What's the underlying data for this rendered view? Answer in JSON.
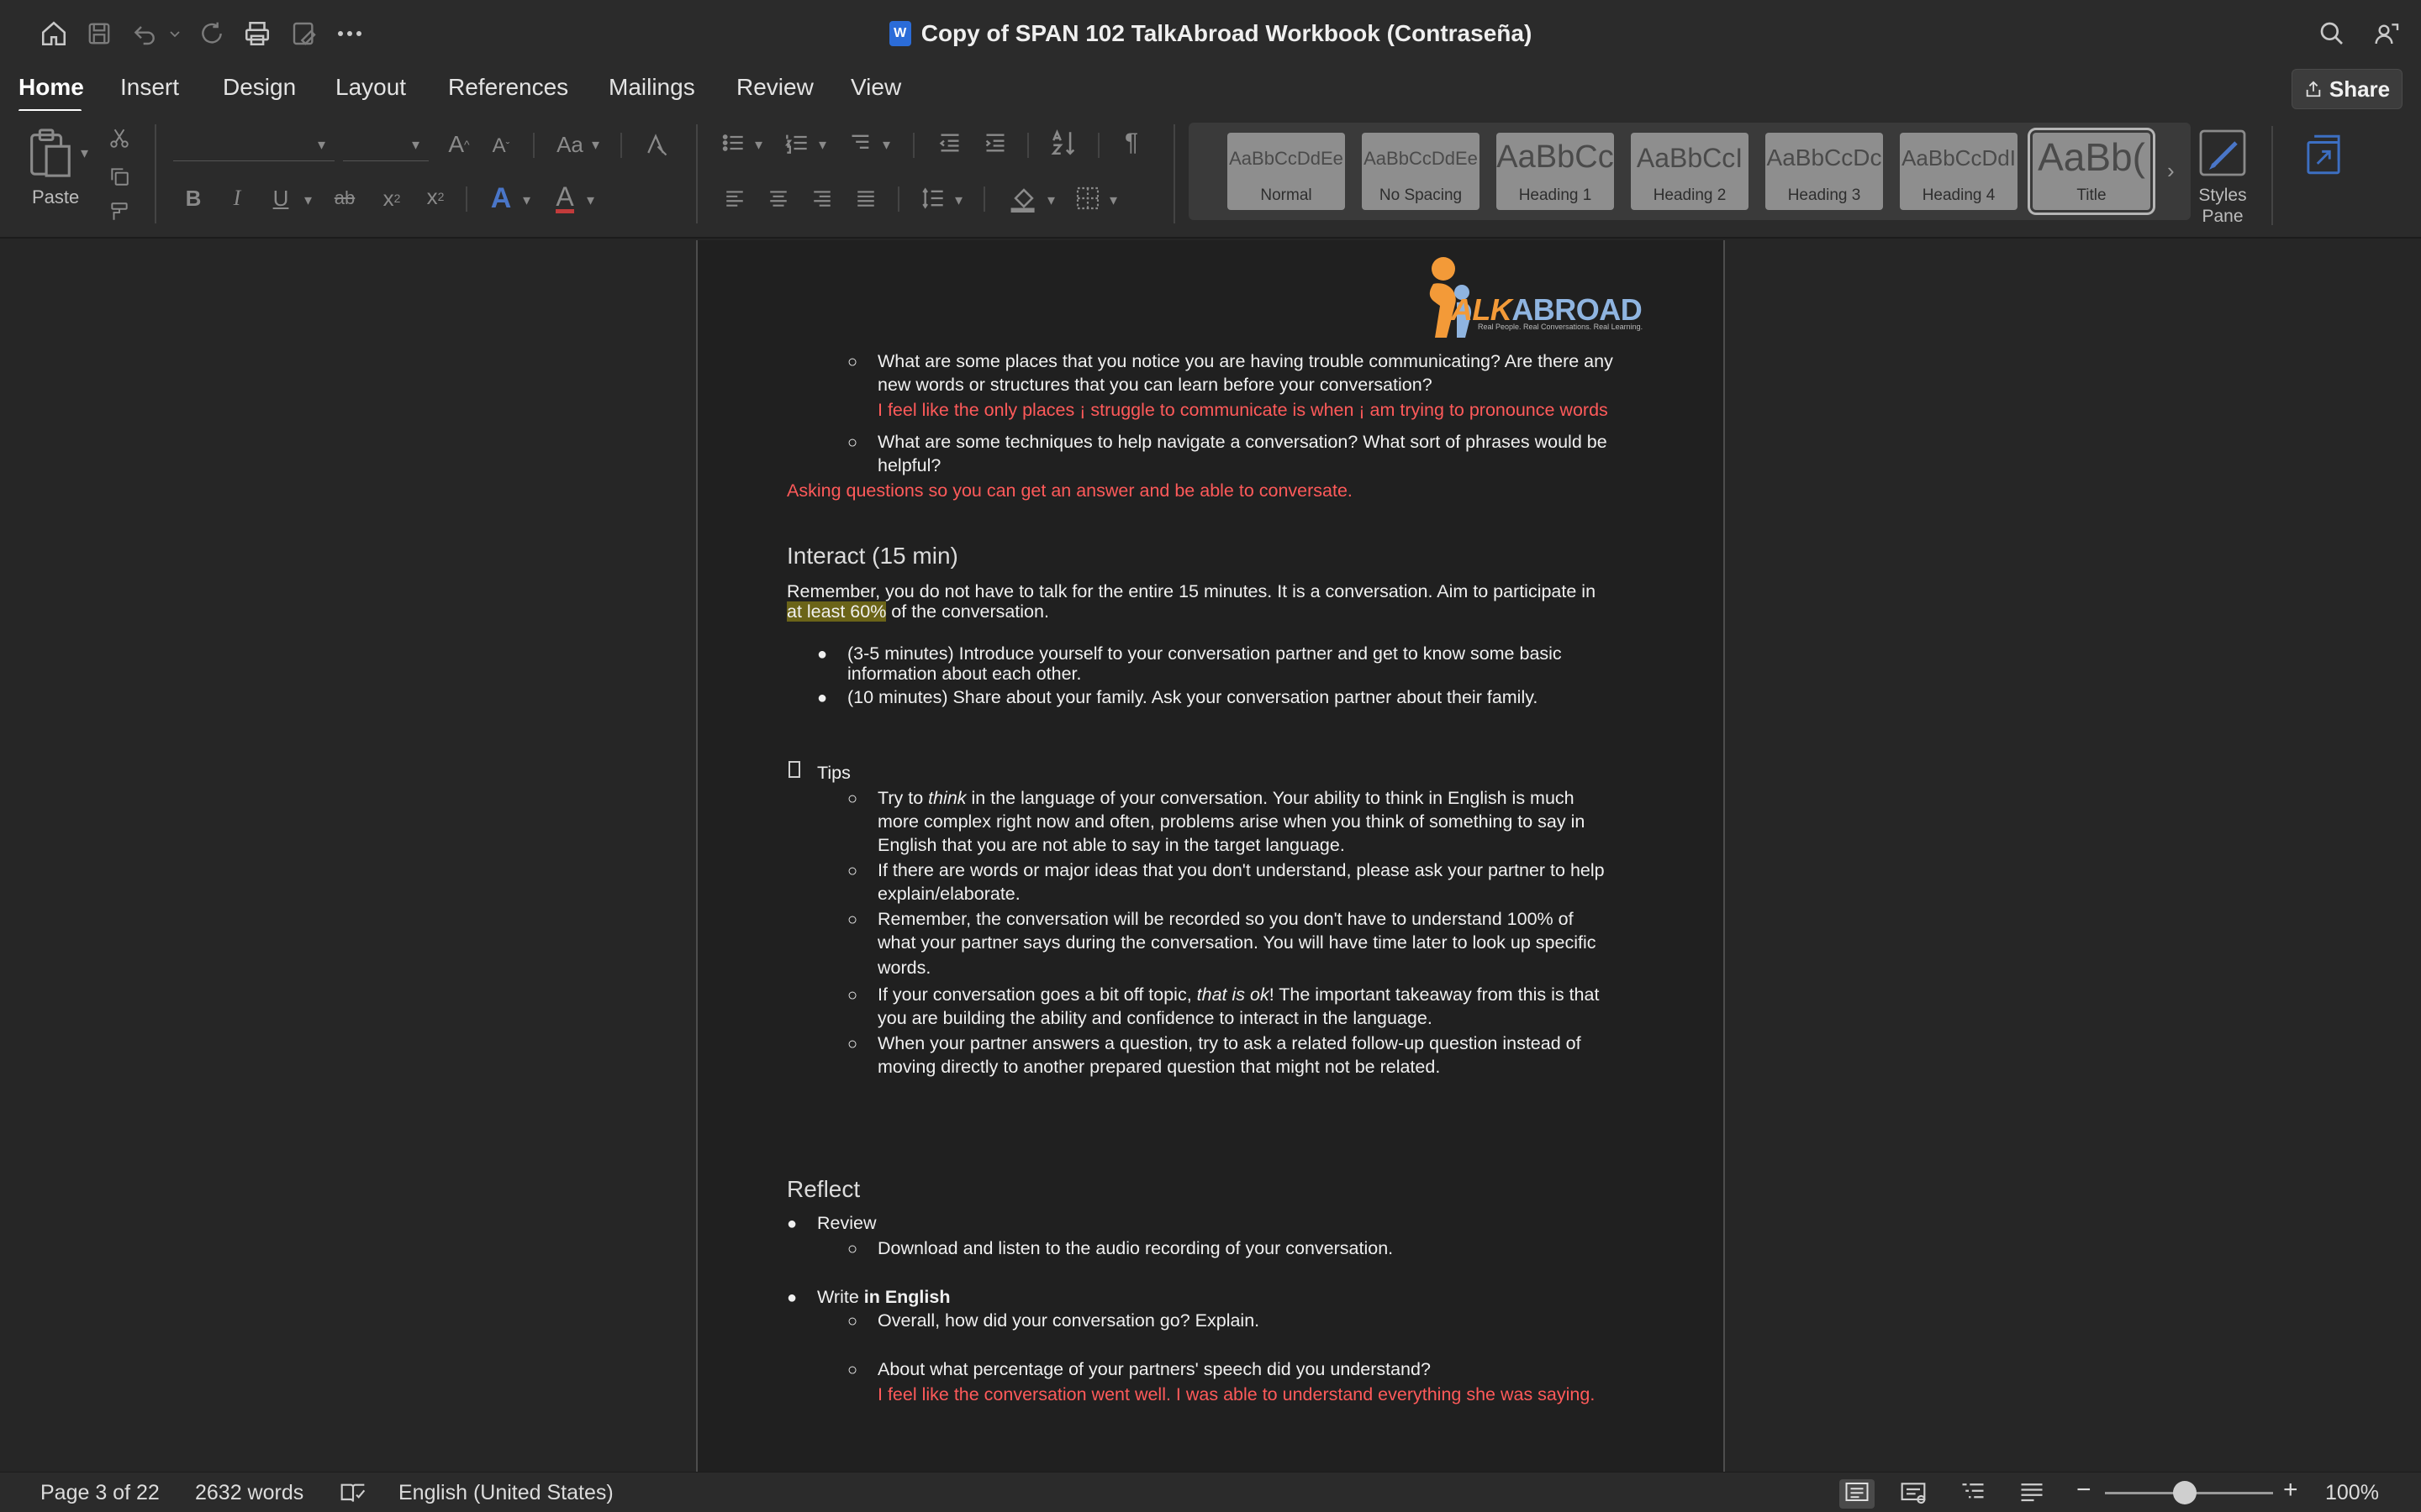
{
  "window": {
    "title": "Copy of SPAN 102 TalkAbroad Workbook (Contraseña)",
    "app_icon": "W"
  },
  "tabs": [
    {
      "label": "Home",
      "active": true
    },
    {
      "label": "Insert"
    },
    {
      "label": "Design"
    },
    {
      "label": "Layout"
    },
    {
      "label": "References"
    },
    {
      "label": "Mailings"
    },
    {
      "label": "Review"
    },
    {
      "label": "View"
    }
  ],
  "share_label": "Share",
  "ribbon": {
    "paste_label": "Paste",
    "font_size_label": "Aa",
    "styles": [
      {
        "sample": "AaBbCcDdEe",
        "label": "Normal",
        "size": "small"
      },
      {
        "sample": "AaBbCcDdEe",
        "label": "No Spacing",
        "size": "small"
      },
      {
        "sample": "AaBbCc",
        "label": "Heading 1",
        "size": "large"
      },
      {
        "sample": "AaBbCcI",
        "label": "Heading 2",
        "size": "medium"
      },
      {
        "sample": "AaBbCcDc",
        "label": "Heading 3",
        "size": "medium-small"
      },
      {
        "sample": "AaBbCcDdI",
        "label": "Heading 4",
        "size": "medium-small"
      },
      {
        "sample": "AaBb(",
        "label": "Title",
        "size": "xlarge",
        "selected": true
      }
    ],
    "styles_pane_label": "Styles Pane"
  },
  "logo": {
    "brand_talk": "TALK",
    "brand_abroad": "ABROAD",
    "tagline": "Real People. Real Conversations. Real Learning."
  },
  "document": {
    "q1_line1": "What are some places that you notice you are having trouble communicating? Are there any",
    "q1_line2": "new words or structures that you can learn before your conversation?",
    "a1": "I feel like the only places ¡ struggle to communicate is when ¡ am trying to pronounce words",
    "q2_line1": "What are some techniques to help navigate a conversation? What sort of phrases would be",
    "q2_line2": "helpful?",
    "a2": "Asking questions so you can get an answer and be able to conversate.",
    "interact_heading": "Interact (15 min)",
    "interact_p_line1": "Remember, you do not have to talk for the entire 15 minutes. It is a conversation. Aim to participate in",
    "interact_p_highlight": "at least 60%",
    "interact_p_rest": " of the conversation.",
    "b1_line1": "(3-5 minutes) Introduce yourself to your conversation partner and get to know some basic",
    "b1_line2": "information about each other.",
    "b2": "(10 minutes) Share about your family. Ask your conversation partner about their family.",
    "tips_bullet": "",
    "tips_label": "Tips",
    "tip1_pre": "Try to ",
    "tip1_em": "think",
    "tip1_post": " in the language of your conversation. Your ability to think in English is much",
    "tip1_line2": "more complex right now and often, problems arise when you think of something to say in",
    "tip1_line3": "English that you are not able to say in the target language.",
    "tip2_line1": "If there are words or major ideas that you don't understand, please ask your partner to help",
    "tip2_line2": "explain/elaborate.",
    "tip3_line1": "Remember, the conversation will be recorded so you don't have to understand 100% of",
    "tip3_line2": "what your partner says during the conversation. You will have time later to look up specific",
    "tip3_line3": "words.",
    "tip4_pre": "If your conversation goes a bit off topic, ",
    "tip4_em": "that is ok",
    "tip4_post": "! The important takeaway from this is that",
    "tip4_line2": "you are building the ability and confidence to interact in the language.",
    "tip5_line1": "When your partner answers a question, try to ask a related follow-up question instead of",
    "tip5_line2": "moving directly to another prepared question that might not be related.",
    "reflect_heading": "Reflect",
    "review_label": "Review",
    "review_item": "Download and listen to the audio recording of your conversation.",
    "write_pre": "Write ",
    "write_bold": "in English",
    "write_q1": "Overall, how did your conversation go? Explain.",
    "write_q2": "About what percentage of your partners' speech did you understand?",
    "write_a2": "I feel like the conversation went well. I was able to understand everything she was saying."
  },
  "status": {
    "page": "Page 3 of 22",
    "words": "2632 words",
    "language": "English (United States)",
    "zoom": "100%"
  }
}
